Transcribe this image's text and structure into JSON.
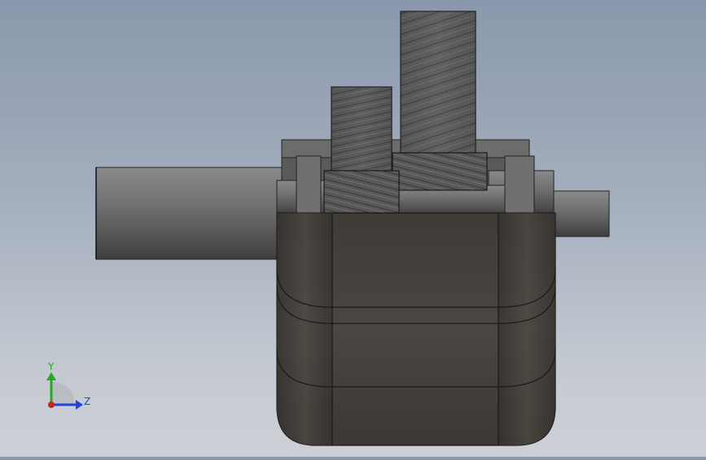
{
  "viewport": {
    "model": "helical-gear-reducer",
    "view": "side-view",
    "colors": {
      "background_top": "#8a98ad",
      "background_bottom": "#cdd0d6",
      "housing": "#47433e",
      "shaft": "#6a6a6a",
      "gear": "#5a5a5a"
    }
  },
  "triad": {
    "y_label": "Y",
    "z_label": "Z",
    "y_color": "#22aa22",
    "z_color": "#2244dd",
    "x_color": "#cc2222"
  }
}
